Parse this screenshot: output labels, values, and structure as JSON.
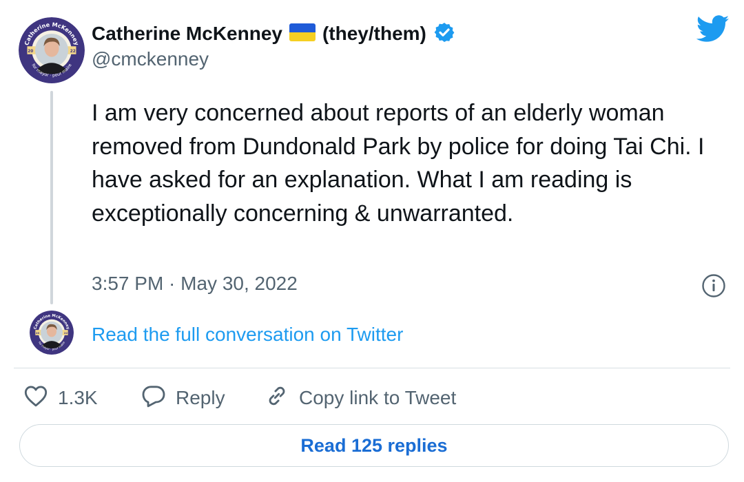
{
  "author": {
    "name": "Catherine McKenney",
    "flag_icon": "ukraine-flag-icon",
    "pronouns": "(they/them)",
    "verified_icon": "verified-badge-icon",
    "handle": "@cmckenney",
    "avatar_badge": {
      "top_text": "Catherine McKenney",
      "year_left": "20",
      "year_right": "22",
      "bottom_text": "for mayor · pour maire"
    }
  },
  "brand": {
    "icon": "twitter-bird-icon",
    "color": "#1d9bf0"
  },
  "tweet": {
    "text": "I am very concerned about reports of an elderly woman removed from Dundonald Park by police for doing Tai Chi. I have asked for an explanation. What I am reading is exceptionally concerning & unwarranted.",
    "timestamp": "3:57 PM · May 30, 2022"
  },
  "info_icon": "info-icon",
  "conversation_link": "Read the full conversation on Twitter",
  "actions": {
    "like": {
      "icon": "heart-icon",
      "count": "1.3K"
    },
    "reply": {
      "icon": "speech-bubble-icon",
      "label": "Reply"
    },
    "copy_link": {
      "icon": "link-icon",
      "label": "Copy link to Tweet"
    }
  },
  "read_replies": "Read 125 replies",
  "colors": {
    "text": "#0f1419",
    "secondary": "#536471",
    "link": "#1d9bf0",
    "badge_navy": "#3f3580",
    "badge_gold": "#f3d78a"
  }
}
